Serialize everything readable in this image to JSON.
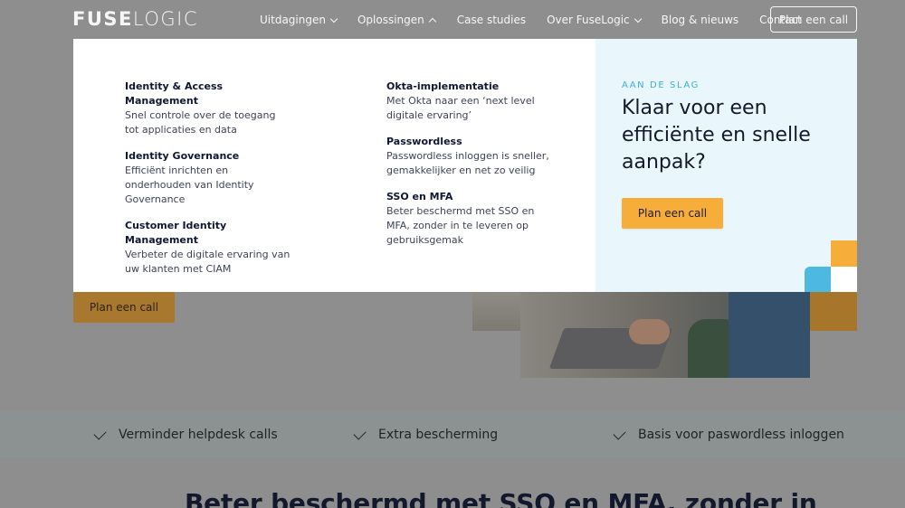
{
  "header": {
    "logo_bold": "FUSE",
    "logo_light": "LOGIC",
    "nav": [
      {
        "label": "Uitdagingen",
        "has_dropdown": true,
        "expanded": false
      },
      {
        "label": "Oplossingen",
        "has_dropdown": true,
        "expanded": true
      },
      {
        "label": "Case studies",
        "has_dropdown": false
      },
      {
        "label": "Over FuseLogic",
        "has_dropdown": true,
        "expanded": false
      },
      {
        "label": "Blog & nieuws",
        "has_dropdown": false
      },
      {
        "label": "Contact",
        "has_dropdown": false
      }
    ],
    "cta_label": "Plan een call"
  },
  "mega_menu": {
    "left_column": [
      {
        "title": "Identity & Access Management",
        "description": "Snel controle over de toegang tot applicaties en data"
      },
      {
        "title": "Identity Governance",
        "description": "Efficiënt inrichten en onderhouden van Identity Governance"
      },
      {
        "title": "Customer Identity Management",
        "description": "Verbeter de digitale ervaring van uw klanten met CIAM"
      }
    ],
    "right_column": [
      {
        "title": "Okta-implementatie",
        "description": "Met Okta naar een ‘next level digitale ervaring’"
      },
      {
        "title": "Passwordless",
        "description": "Passwordless inloggen is sneller, gemakkelijker en net zo veilig"
      },
      {
        "title": "SSO en MFA",
        "description": "Beter beschermd met SSO en MFA, zonder in te leveren op gebruiksgemak"
      }
    ],
    "promo": {
      "eyebrow": "AAN DE SLAG",
      "heading": "Klaar voor een efficiënte en snelle aanpak?",
      "cta_label": "Plan een call"
    }
  },
  "background": {
    "cta_label": "Plan een call",
    "benefits": [
      "Verminder helpdesk calls",
      "Extra bescherming",
      "Basis voor paswordless inloggen"
    ],
    "section_heading": "Beter beschermd met SSO en MFA, zonder in"
  },
  "colors": {
    "accent_orange": "#f7ad3a",
    "accent_blue": "#4db9e0",
    "promo_bg": "#e9f7fc",
    "text_dark": "#14182c",
    "overlay_gray": "#8e8e8e"
  }
}
